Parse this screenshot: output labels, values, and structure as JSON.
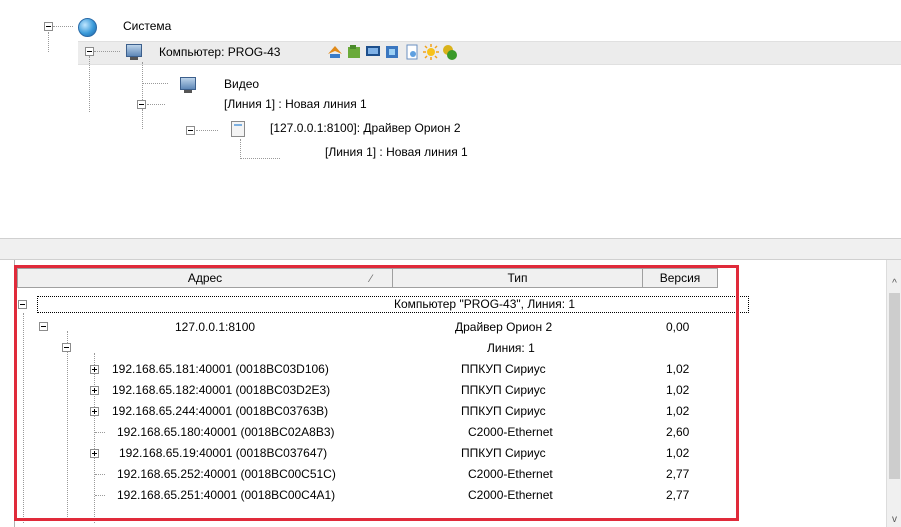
{
  "tree": {
    "system_label": "Система",
    "computer_label": "Компьютер: PROG-43",
    "video_label": "Видео",
    "line1_label": "[Линия 1] : Новая линия 1",
    "driver_label": "[127.0.0.1:8100]: Драйвер Орион 2",
    "driver_line_label": "[Линия 1] : Новая линия 1",
    "toolbar_icons": [
      "firewall-icon",
      "folder-icon",
      "monitor-icon",
      "network-icon",
      "document-icon",
      "sun-icon",
      "coins-icon"
    ]
  },
  "grid": {
    "columns": [
      "Адрес",
      "Тип",
      "Версия"
    ],
    "group_label": "Компьютер \"PROG-43\", Линия: 1",
    "rows": [
      {
        "address": "127.0.0.1:8100",
        "type": "Драйвер Орион 2",
        "version": "0,00"
      },
      {
        "address": "",
        "type": "Линия: 1",
        "version": ""
      },
      {
        "address": "192.168.65.181:40001 (0018BC03D106)",
        "type": "ППКУП Сириус",
        "version": "1,02"
      },
      {
        "address": "192.168.65.182:40001 (0018BC03D2E3)",
        "type": "ППКУП Сириус",
        "version": "1,02"
      },
      {
        "address": "192.168.65.244:40001 (0018BC03763B)",
        "type": "ППКУП Сириус",
        "version": "1,02"
      },
      {
        "address": "192.168.65.180:40001 (0018BC02A8B3)",
        "type": "С2000-Ethernet",
        "version": "2,60"
      },
      {
        "address": "192.168.65.19:40001 (0018BC037647)",
        "type": "ППКУП Сириус",
        "version": "1,02"
      },
      {
        "address": "192.168.65.252:40001 (0018BC00C51C)",
        "type": "С2000-Ethernet",
        "version": "2,77"
      },
      {
        "address": "192.168.65.251:40001 (0018BC00C4A1)",
        "type": "С2000-Ethernet",
        "version": "2,77"
      }
    ]
  },
  "colors": {
    "highlight": "#e02a3a",
    "selected_row": "#ececec"
  }
}
